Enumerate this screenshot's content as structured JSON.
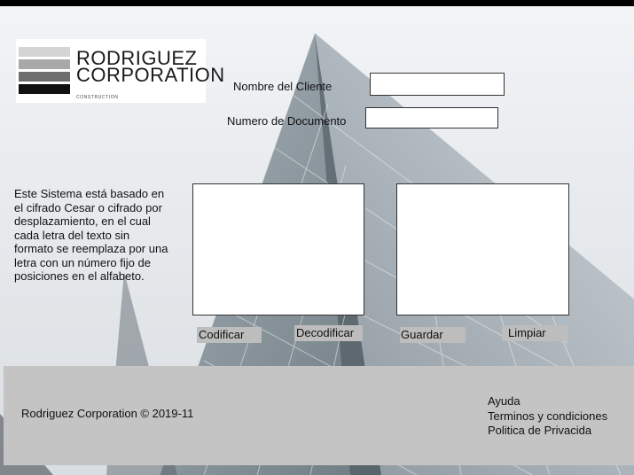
{
  "logo": {
    "line1": "RODRIGUEZ",
    "line2": "CORPORATION",
    "tagline": "CONSTRUCTION",
    "bar_colors": [
      "#d4d4d4",
      "#a8a8a8",
      "#6e6e6e",
      "#111111"
    ]
  },
  "form": {
    "client_name_label": "Nombre del Cliente",
    "client_name_value": "",
    "document_number_label": "Numero de Documento",
    "document_number_value": ""
  },
  "description": "Este Sistema está basado en el cifrado Cesar o cifrado por desplazamiento, en el cual cada letra del texto sin formato se reemplaza por una letra con un número fijo de posiciones en el alfabeto.",
  "buttons": {
    "encode": "Codificar",
    "decode": "Decodificar",
    "save": "Guardar",
    "clear": "Limpiar"
  },
  "footer": {
    "copyright": "Rodriguez Corporation © 2019-11",
    "links": [
      "Ayuda",
      "Terminos y condiciones",
      "Politica de Privacida"
    ]
  },
  "colors": {
    "button_bg": "#bdbdbd",
    "footer_bg": "#c4c4c4"
  }
}
